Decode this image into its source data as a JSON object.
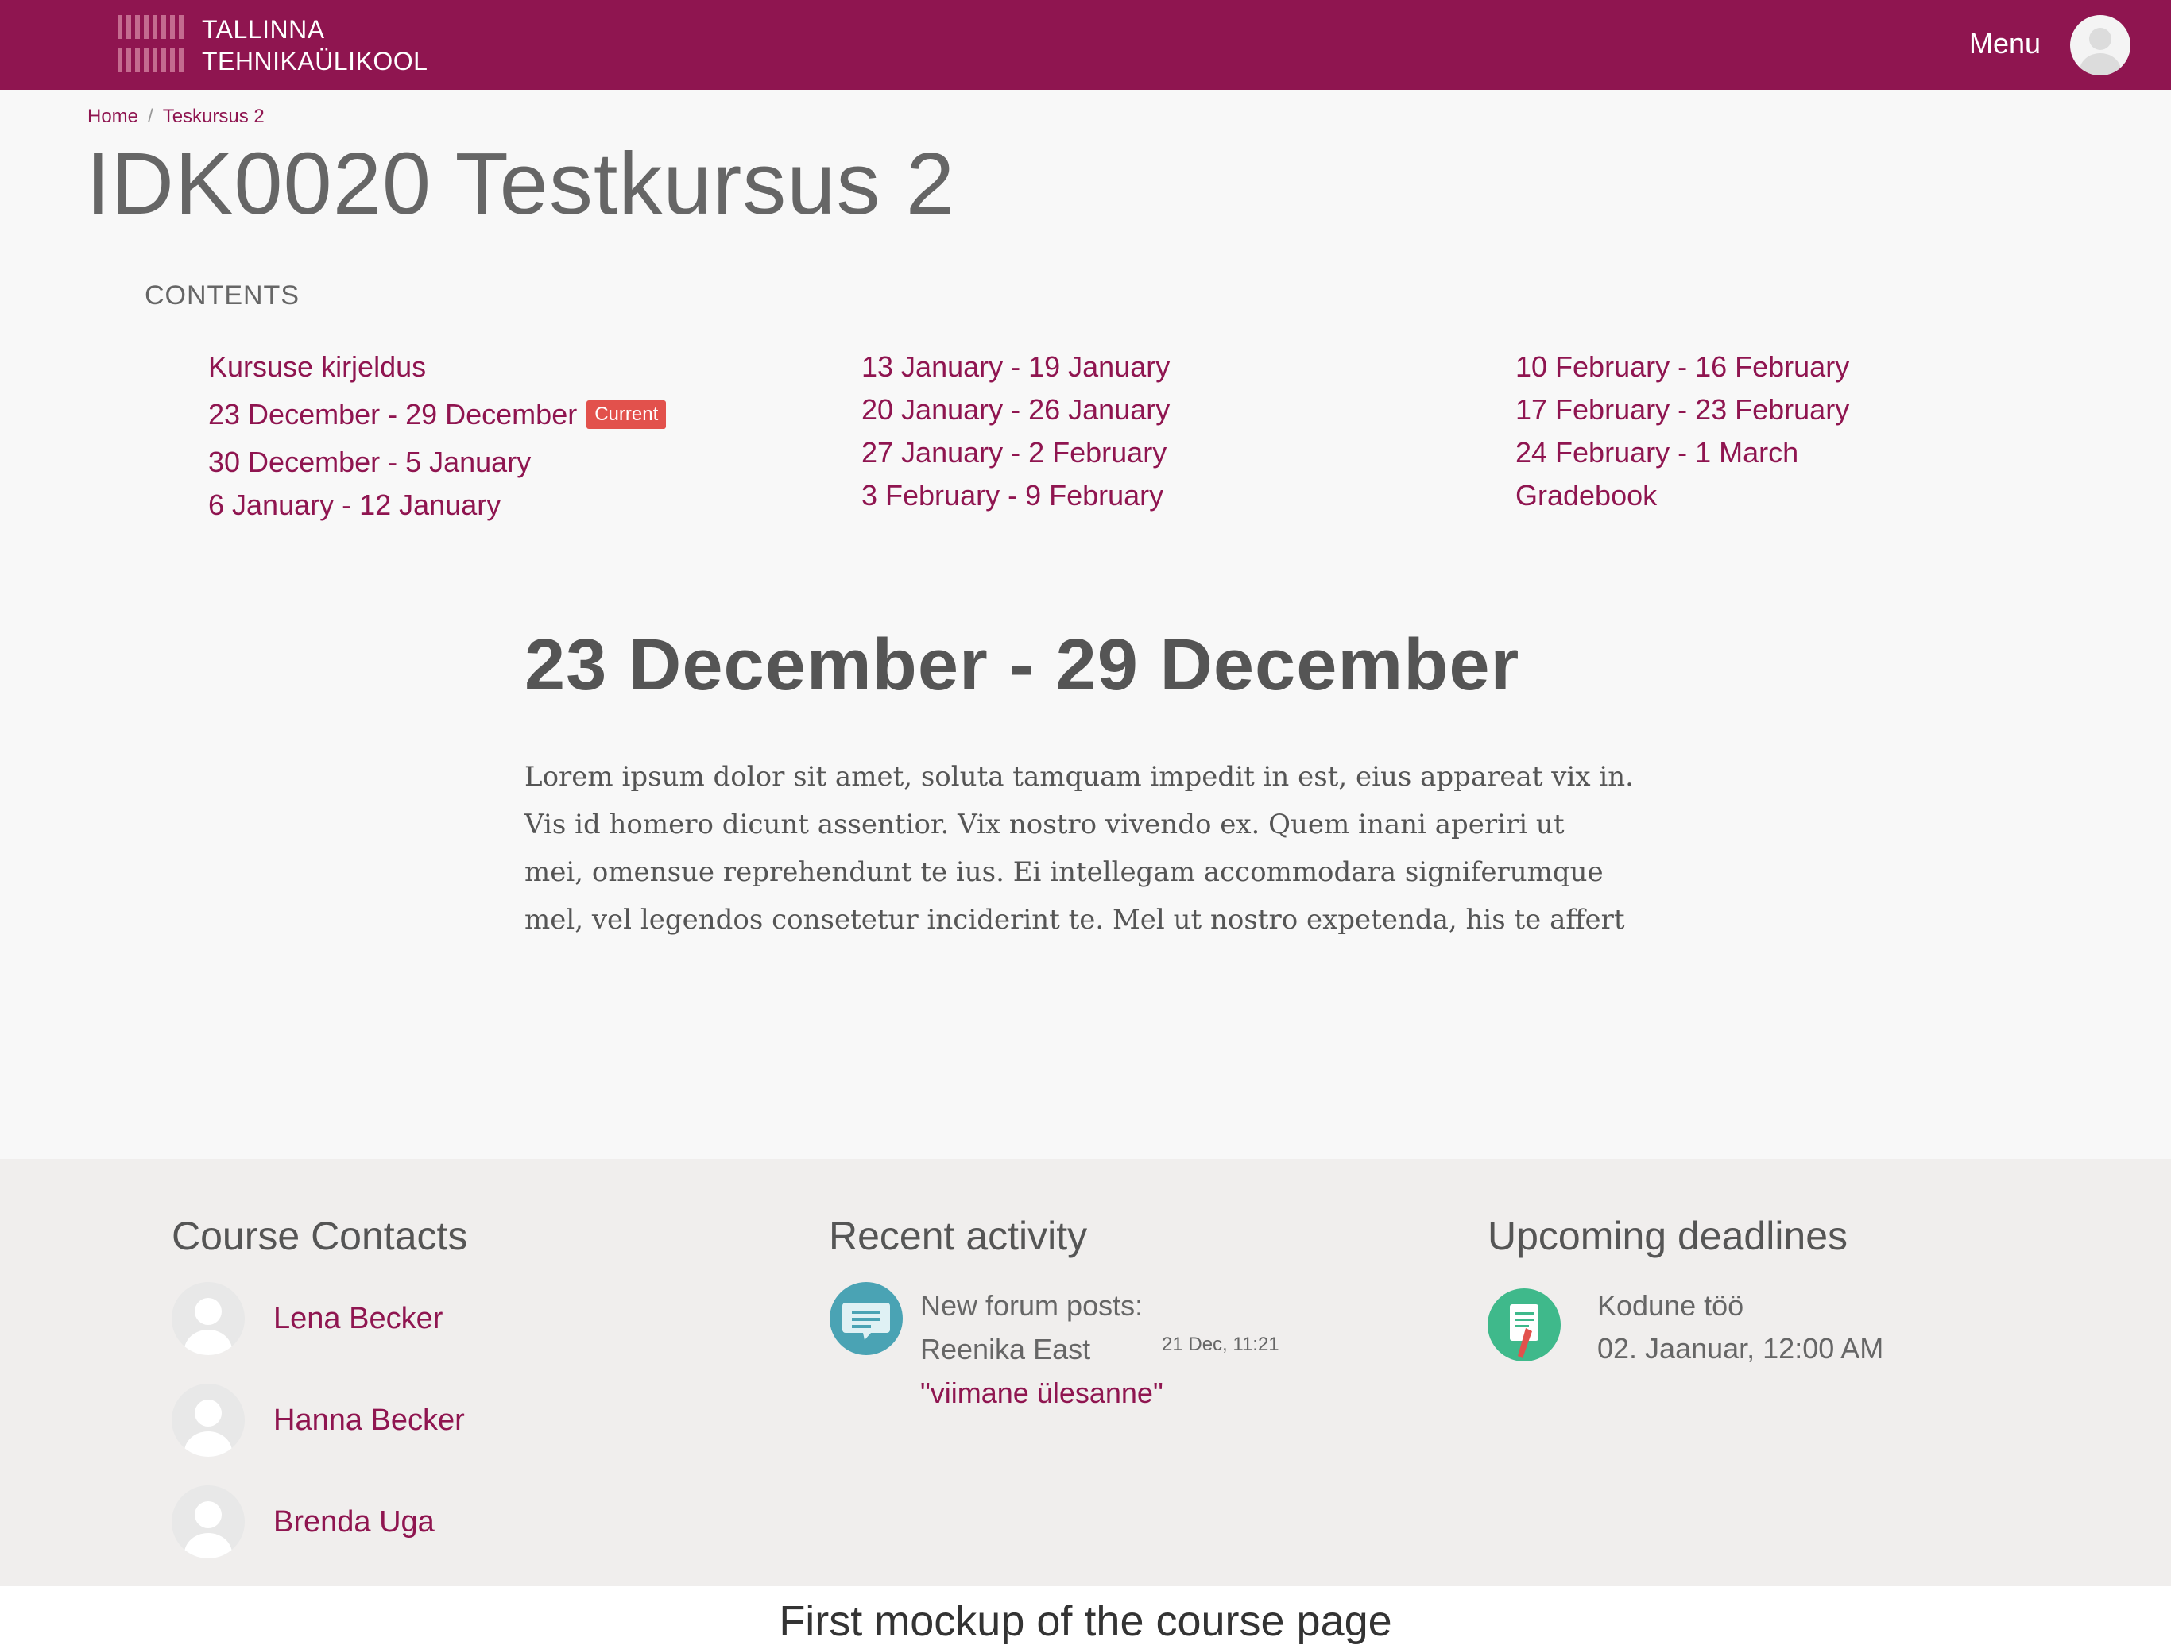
{
  "header": {
    "logo_line1": "TALLINNA",
    "logo_line2": "TEHNIKAÜLIKOOL",
    "menu_label": "Menu",
    "brand_color": "#8f1550"
  },
  "breadcrumb": {
    "home": "Home",
    "separator": "/",
    "current": "Teskursus 2"
  },
  "course": {
    "title": "IDK0020 Testkursus 2"
  },
  "contents": {
    "label": "CONTENTS",
    "col1": [
      "Kursuse kirjeldus",
      "23 December - 29 December",
      "30 December - 5 January",
      "6 January - 12 January"
    ],
    "current_badge": "Current",
    "col2": [
      "13 January - 19 January",
      "20 January - 26 January",
      "27 January - 2 February",
      "3 February - 9 February"
    ],
    "col3": [
      "10 February - 16 February",
      "17 February - 23 February",
      "24 February - 1 March",
      "Gradebook"
    ]
  },
  "section": {
    "title": "23 December - 29 December",
    "body_lines": [
      "Lorem ipsum dolor sit amet, soluta tamquam impedit in est, eius appareat vix in.",
      "Vis id homero dicunt assentior. Vix nostro vivendo ex. Quem inani aperiri ut",
      "mei, omensue reprehendunt te ius. Ei intellegam accommodara signiferumque",
      "mel, vel legendos consetetur inciderint te. Mel ut nostro expetenda, his te affert"
    ]
  },
  "footer": {
    "contacts_title": "Course Contacts",
    "contacts": [
      "Lena Becker",
      "Hanna Becker",
      "Brenda Uga"
    ],
    "activity_title": "Recent activity",
    "activity": {
      "heading": "New forum posts:",
      "author": "Reenika East",
      "post": "\"viimane ülesanne\"",
      "time": "21 Dec, 11:21"
    },
    "deadlines_title": "Upcoming deadlines",
    "deadline": {
      "name": "Kodune töö",
      "date": "02. Jaanuar, 12:00 AM"
    }
  },
  "caption": "First mockup of the course page"
}
